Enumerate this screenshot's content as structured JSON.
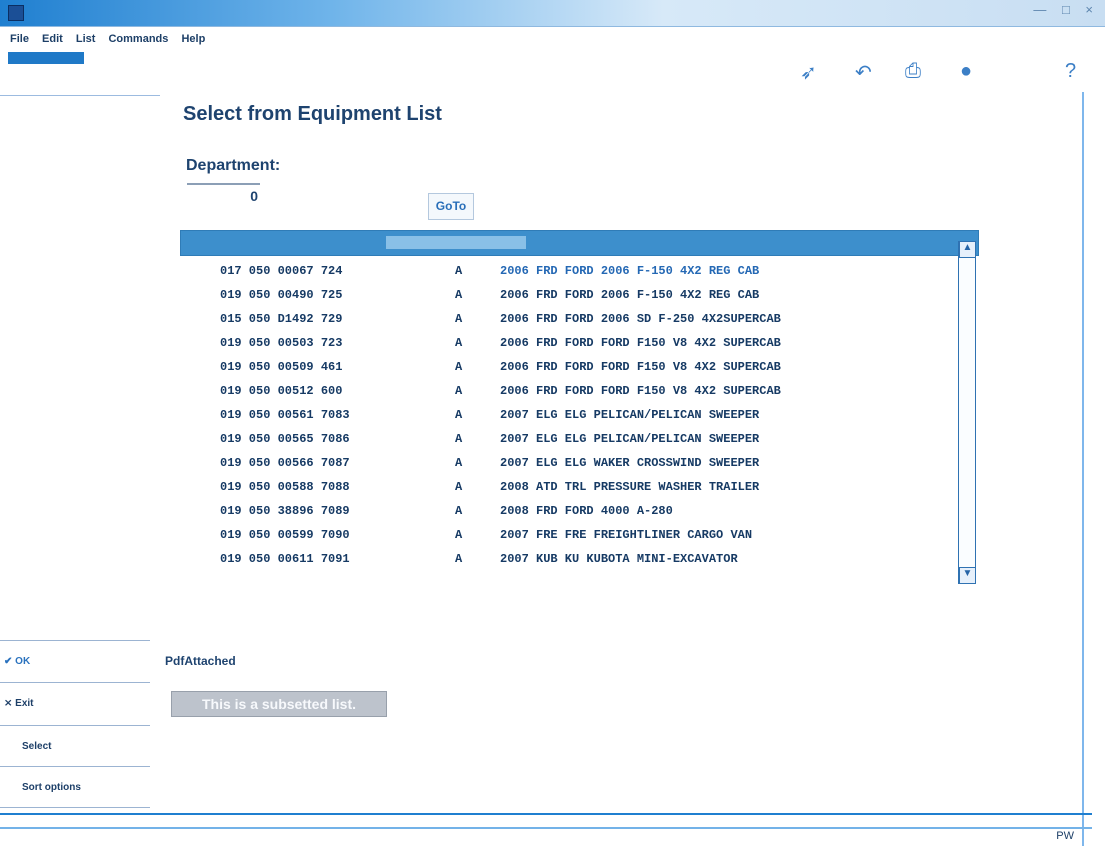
{
  "window": {
    "title": "",
    "controls": "— □ ×"
  },
  "menu": {
    "items": [
      "File",
      "Edit",
      "List",
      "Commands",
      "Help"
    ]
  },
  "toolbar": {
    "icons": [
      "pointer-icon",
      "back-icon",
      "printer-icon",
      "save-icon",
      "help-icon"
    ]
  },
  "page": {
    "title": "Select from Equipment List",
    "department_label": "Department:",
    "department_value": "0",
    "goto_label": "GoTo"
  },
  "list": {
    "rows": [
      {
        "code": "017 050 00067 724",
        "status": "A",
        "desc": "2006 FRD FORD 2006 F-150 4X2 REG CAB"
      },
      {
        "code": "019 050 00490 725",
        "status": "A",
        "desc": "2006 FRD FORD 2006 F-150 4X2 REG CAB"
      },
      {
        "code": "015 050 D1492 729",
        "status": "A",
        "desc": "2006 FRD FORD 2006 SD F-250 4X2SUPERCAB"
      },
      {
        "code": "019 050 00503 723",
        "status": "A",
        "desc": "2006 FRD FORD FORD F150 V8 4X2 SUPERCAB"
      },
      {
        "code": "019 050 00509 461",
        "status": "A",
        "desc": "2006 FRD FORD FORD F150 V8 4X2 SUPERCAB"
      },
      {
        "code": "019 050 00512 600",
        "status": "A",
        "desc": "2006 FRD FORD FORD F150 V8 4X2 SUPERCAB"
      },
      {
        "code": "019 050 00561 7083",
        "status": "A",
        "desc": "2007 ELG ELG PELICAN/PELICAN SWEEPER"
      },
      {
        "code": "019 050 00565 7086",
        "status": "A",
        "desc": "2007 ELG ELG PELICAN/PELICAN SWEEPER"
      },
      {
        "code": "019 050 00566 7087",
        "status": "A",
        "desc": "2007 ELG ELG WAKER CROSSWIND SWEEPER"
      },
      {
        "code": "019 050 00588 7088",
        "status": "A",
        "desc": "2008 ATD TRL PRESSURE WASHER TRAILER"
      },
      {
        "code": "019 050 38896 7089",
        "status": "A",
        "desc": "2008 FRD FORD 4000 A-280"
      },
      {
        "code": "019 050 00599 7090",
        "status": "A",
        "desc": "2007 FRE FRE FREIGHTLINER CARGO VAN"
      },
      {
        "code": "019 050 00611 7091",
        "status": "A",
        "desc": "2007 KUB KU KUBOTA MINI-EXCAVATOR"
      }
    ]
  },
  "left_panel": {
    "ok_label": "OK",
    "exit_label": "Exit",
    "select_label": "Select",
    "sort_label": "Sort options"
  },
  "pdf_label": "PdfAttached",
  "subset_banner": "This is a subsetted list.",
  "status_bar": "PW"
}
